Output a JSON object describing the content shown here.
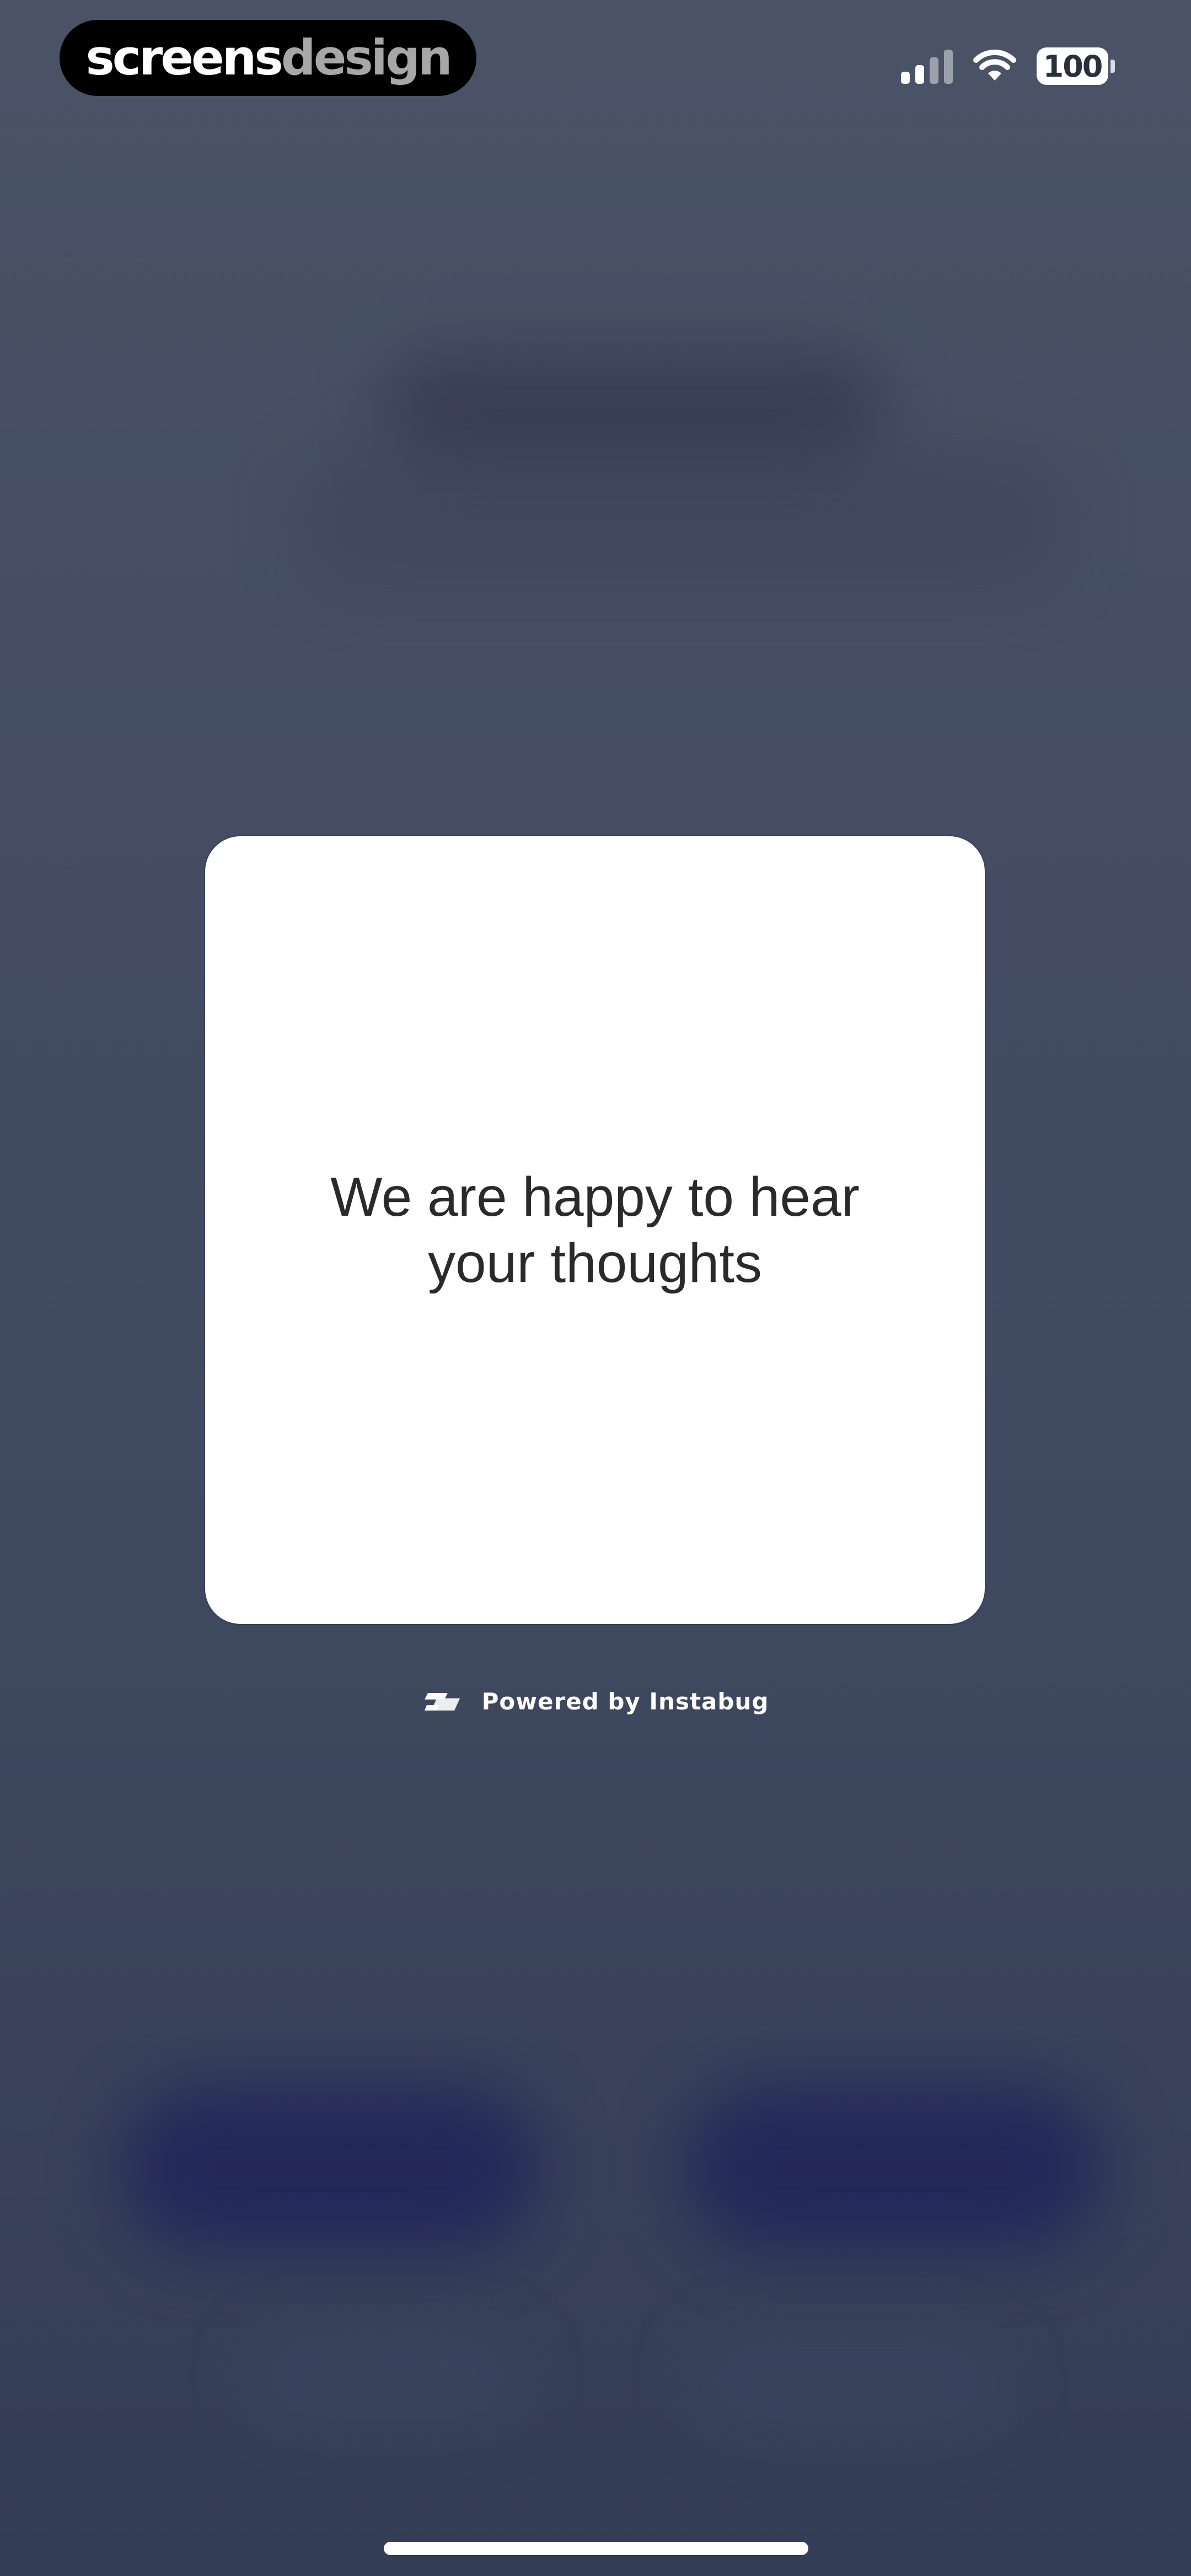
{
  "status_bar": {
    "brand": {
      "part1": "screens",
      "part2": "design"
    },
    "signal_icon": "cellular-signal-icon",
    "wifi_icon": "wifi-icon",
    "battery_level": "100"
  },
  "feedback_modal": {
    "message": "We are happy to hear\nyour thoughts"
  },
  "footer": {
    "powered_by_icon": "instabug-logo-icon",
    "powered_by_text": "Powered by Instabug"
  },
  "colors": {
    "background": "#434d63",
    "card": "#ffffff",
    "text": "#2a2a2e",
    "brand_secondary": "#a7a7a7"
  }
}
